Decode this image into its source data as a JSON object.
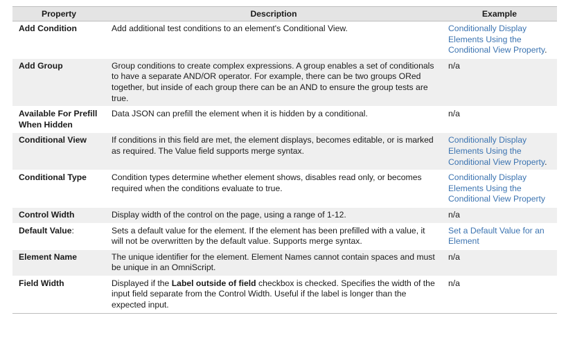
{
  "headers": {
    "property": "Property",
    "description": "Description",
    "example": "Example"
  },
  "rows": [
    {
      "property": "Add Condition",
      "description": "Add additional test conditions to an element's Conditional View.",
      "example_link": "Conditionally Display Elements Using the Conditional View Property",
      "example_suffix": "."
    },
    {
      "property": "Add Group",
      "description": "Group conditions to create complex expressions. A group enables a set of conditionals to have a separate AND/OR operator. For example, there can be two groups ORed together, but inside of each group there can be an AND to ensure the group tests are true.",
      "example_text": "n/a"
    },
    {
      "property": "Available For Prefill When Hidden",
      "description": "Data JSON can prefill the element when it is hidden by a conditional.",
      "example_text": "n/a"
    },
    {
      "property": "Conditional View",
      "description": "If conditions in this field are met, the element displays, becomes editable, or is marked as required. The Value field supports merge syntax.",
      "example_link": "Conditionally Display Elements Using the Conditional View Property",
      "example_suffix": "."
    },
    {
      "property": "Conditional Type",
      "description": "Condition types determine whether element shows, disables read only, or becomes required when the conditions evaluate to true.",
      "example_link": "Conditionally Display Elements Using the Conditional View Property"
    },
    {
      "property": "Control Width",
      "description": "Display width of the control on the page, using a range of 1-12.",
      "example_text": "n/a"
    },
    {
      "property": "Default Value",
      "property_suffix": ":",
      "description": "Sets a default value for the element. If the element has been prefilled with a value, it will not be overwritten by the default value. Supports merge syntax.",
      "example_link": "Set a Default Value for an Element"
    },
    {
      "property": "Element Name",
      "description": "The unique identifier for the element. Element Names cannot contain spaces and must be unique in an OmniScript.",
      "example_text": "n/a"
    },
    {
      "property": "Field Width",
      "description_before": "Displayed if the ",
      "description_bold": "Label outside of field",
      "description_after": " checkbox is checked. Specifies the width of the input field separate from the Control Width. Useful if the label is longer than the expected input.",
      "example_text": "n/a"
    }
  ]
}
